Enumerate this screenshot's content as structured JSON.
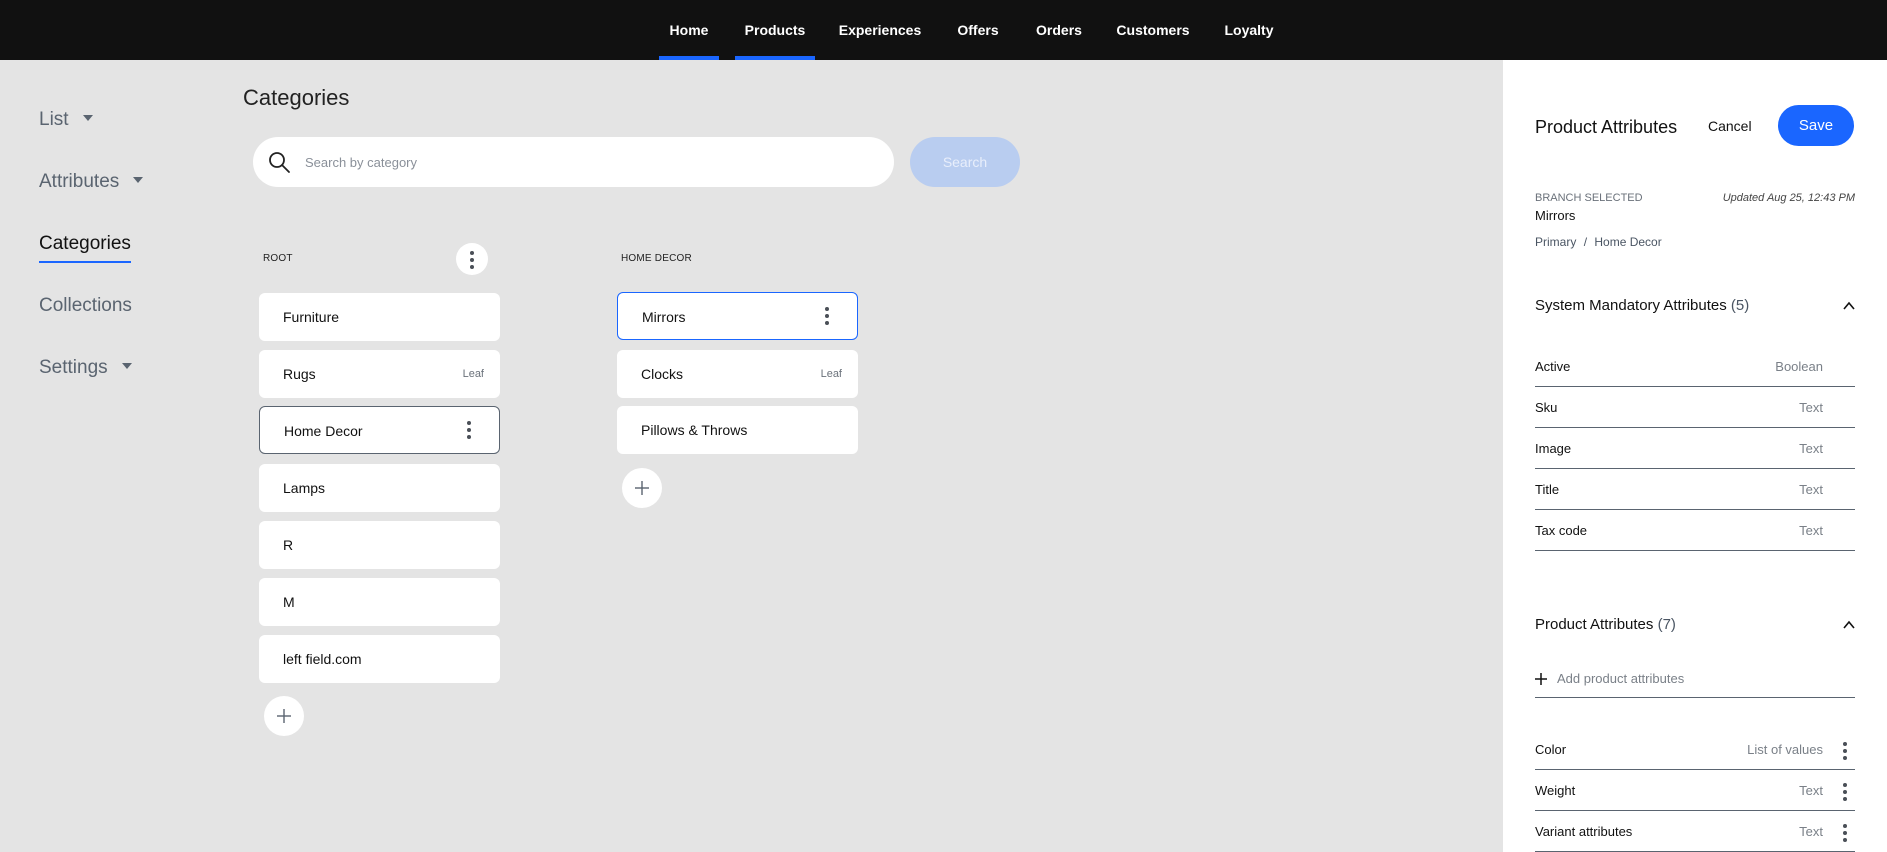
{
  "topnav": {
    "items": [
      {
        "label": "Home",
        "active": true
      },
      {
        "label": "Products",
        "active": true
      },
      {
        "label": "Experiences",
        "active": false
      },
      {
        "label": "Offers",
        "active": false
      },
      {
        "label": "Orders",
        "active": false
      },
      {
        "label": "Customers",
        "active": false
      },
      {
        "label": "Loyalty",
        "active": false
      }
    ],
    "accent_color": "#1a66ff",
    "background": "#111111"
  },
  "sidebar": {
    "items": [
      {
        "label": "List",
        "has_caret": true
      },
      {
        "label": "Attributes",
        "has_caret": true
      },
      {
        "label": "Categories",
        "active": true
      },
      {
        "label": "Collections"
      },
      {
        "label": "Settings",
        "has_caret": true
      }
    ]
  },
  "page": {
    "title": "Categories",
    "search": {
      "placeholder": "Search by category",
      "button_label": "Search"
    }
  },
  "columns": {
    "root": {
      "label": "ROOT",
      "items": [
        {
          "name": "Furniture",
          "badge": ""
        },
        {
          "name": "Rugs",
          "badge": "Leaf"
        },
        {
          "name": "Home Decor",
          "badge": "",
          "selected": true
        },
        {
          "name": "Lamps",
          "badge": ""
        },
        {
          "name": "R",
          "badge": ""
        },
        {
          "name": "M",
          "badge": ""
        },
        {
          "name": "left field.com",
          "badge": ""
        }
      ]
    },
    "home_decor": {
      "label": "HOME DECOR",
      "items": [
        {
          "name": "Mirrors",
          "badge": "",
          "selected": true
        },
        {
          "name": "Clocks",
          "badge": "Leaf"
        },
        {
          "name": "Pillows & Throws",
          "badge": ""
        }
      ]
    }
  },
  "panel": {
    "title": "Product Attributes",
    "cancel_label": "Cancel",
    "save_label": "Save",
    "branch_label": "BRANCH SELECTED",
    "updated": "Updated Aug 25, 12:43 PM",
    "branch_name": "Mirrors",
    "breadcrumb": [
      "Primary",
      "/",
      "Home Decor"
    ],
    "system_section": {
      "title": "System Mandatory Attributes",
      "count": "(5)"
    },
    "system_attributes": [
      {
        "name": "Active",
        "type": "Boolean"
      },
      {
        "name": "Sku",
        "type": "Text"
      },
      {
        "name": "Image",
        "type": "Text"
      },
      {
        "name": "Title",
        "type": "Text"
      },
      {
        "name": "Tax code",
        "type": "Text"
      }
    ],
    "product_section": {
      "title": "Product Attributes",
      "count": "(7)"
    },
    "add_attr_label": "Add product attributes",
    "product_attributes": [
      {
        "name": "Color",
        "type": "List of values"
      },
      {
        "name": "Weight",
        "type": "Text"
      },
      {
        "name": "Variant attributes",
        "type": "Text"
      }
    ]
  }
}
